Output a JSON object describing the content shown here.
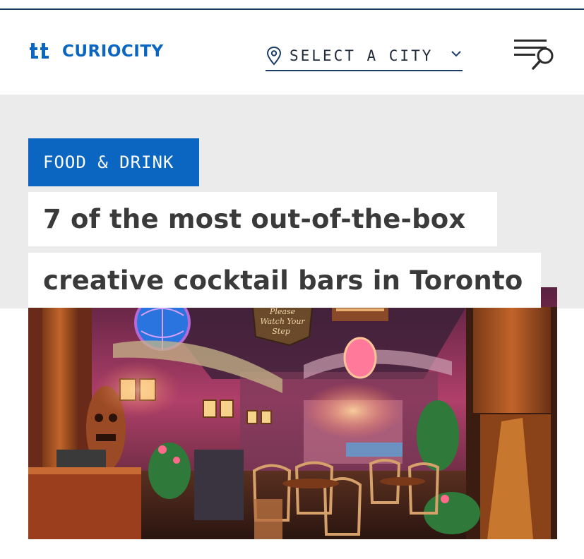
{
  "header": {
    "logo_text": "CURIOCITY",
    "city_selector": {
      "label": "SELECT A CITY"
    },
    "icons": {
      "menu": "menu-search-icon",
      "location": "location-pin-icon",
      "chevron": "chevron-down-icon"
    }
  },
  "article": {
    "category": "FOOD & DRINK",
    "title_line_1": "7 of the most out-of-the-box",
    "title_line_2": "creative cocktail bars in Toronto",
    "image_sign_text": [
      "Please",
      "Watch Your",
      "Step"
    ]
  },
  "colors": {
    "brand_blue": "#0b66c2",
    "navy": "#1c3d66",
    "hero_band": "#ebebeb",
    "headline_text": "#3a3a3a"
  }
}
